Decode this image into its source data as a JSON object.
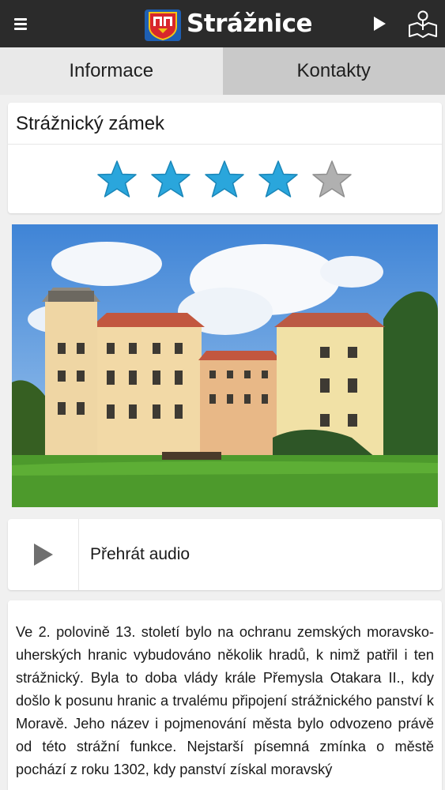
{
  "header": {
    "title": "Strážnice",
    "icons": [
      "menu-icon",
      "city-coat-of-arms-logo",
      "play-icon",
      "map-pin-icon"
    ]
  },
  "tabs": [
    {
      "label": "Informace",
      "active": true
    },
    {
      "label": "Kontakty",
      "active": false
    }
  ],
  "place": {
    "title": "Strážnický zámek",
    "rating": 4,
    "rating_max": 5,
    "photo": "castle-photo"
  },
  "audio": {
    "label": "Přehrát audio",
    "icon": "play-icon"
  },
  "description": {
    "text": "Ve 2. polovině 13. století bylo na ochranu zemských moravsko-uherských hranic vybudováno několik hradů, k nimž patřil i ten strážnický. Byla to doba vlády krále Přemysla Otakara II., kdy došlo k posunu hranic a trvalému připojení strážnického panství k Moravě. Jeho název i pojmenování města bylo odvozeno právě od této strážní funkce. Nejstarší písemná zmínka o městě pochází z roku 1302, kdy panství získal moravský"
  },
  "colors": {
    "topbar": "#2b2b2b",
    "tab_active": "#e9e9e9",
    "tab_inactive": "#c9c9c9",
    "star_filled": "#2aa6dc",
    "star_empty": "#b0b0b0",
    "background": "#f0f0f0"
  }
}
